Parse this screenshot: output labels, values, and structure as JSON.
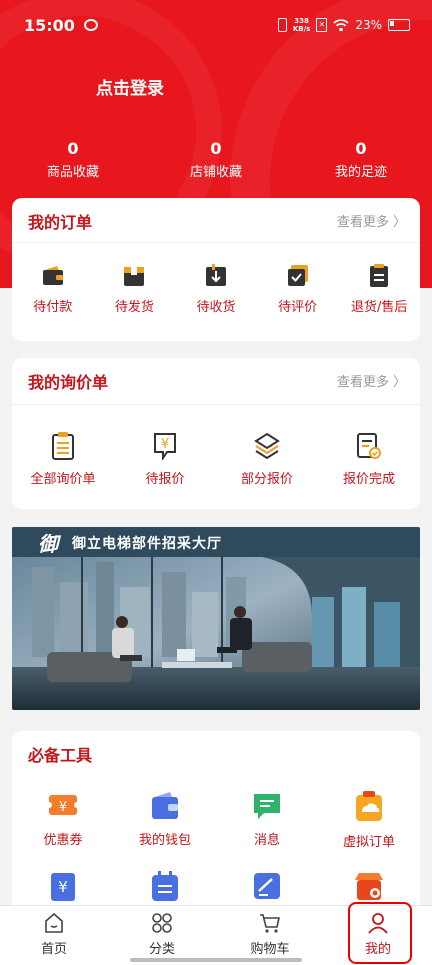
{
  "status": {
    "time": "15:00",
    "speed_top": "338",
    "speed_bottom": "KB/s",
    "battery": "23%"
  },
  "profile": {
    "login": "点击登录"
  },
  "stats": [
    {
      "value": "0",
      "label": "商品收藏"
    },
    {
      "value": "0",
      "label": "店铺收藏"
    },
    {
      "value": "0",
      "label": "我的足迹"
    }
  ],
  "orders": {
    "title": "我的订单",
    "more": "查看更多",
    "items": [
      {
        "label": "待付款",
        "icon": "wallet-icon"
      },
      {
        "label": "待发货",
        "icon": "package-icon"
      },
      {
        "label": "待收货",
        "icon": "receive-box-icon"
      },
      {
        "label": "待评价",
        "icon": "review-check-icon"
      },
      {
        "label": "退货/售后",
        "icon": "return-doc-icon"
      }
    ]
  },
  "inquiry": {
    "title": "我的询价单",
    "more": "查看更多",
    "items": [
      {
        "label": "全部询价单",
        "icon": "clipboard-list-icon"
      },
      {
        "label": "待报价",
        "icon": "yen-doc-icon"
      },
      {
        "label": "部分报价",
        "icon": "layers-icon"
      },
      {
        "label": "报价完成",
        "icon": "doc-check-icon"
      }
    ]
  },
  "banner": {
    "logo": "御",
    "text": "御立电梯部件招采大厅"
  },
  "tools": {
    "title": "必备工具",
    "items": [
      {
        "label": "优惠券",
        "icon": "coupon-icon",
        "color": "#f57c2c"
      },
      {
        "label": "我的钱包",
        "icon": "wallet-blue-icon",
        "color": "#4a6fe3"
      },
      {
        "label": "消息",
        "icon": "message-icon",
        "color": "#2fb36b"
      },
      {
        "label": "虚拟订单",
        "icon": "cloud-order-icon",
        "color": "#f5a623"
      }
    ],
    "partial": [
      {
        "icon": "yen-ticket-icon",
        "color": "#4a6fe3"
      },
      {
        "icon": "calendar-icon",
        "color": "#4a6fe3"
      },
      {
        "icon": "edit-note-icon",
        "color": "#4a6fe3"
      },
      {
        "icon": "store-icon",
        "color": "#e8461d"
      }
    ]
  },
  "tabs": [
    {
      "label": "首页",
      "icon": "home-icon"
    },
    {
      "label": "分类",
      "icon": "category-icon"
    },
    {
      "label": "购物车",
      "icon": "cart-icon"
    },
    {
      "label": "我的",
      "icon": "user-icon"
    }
  ]
}
